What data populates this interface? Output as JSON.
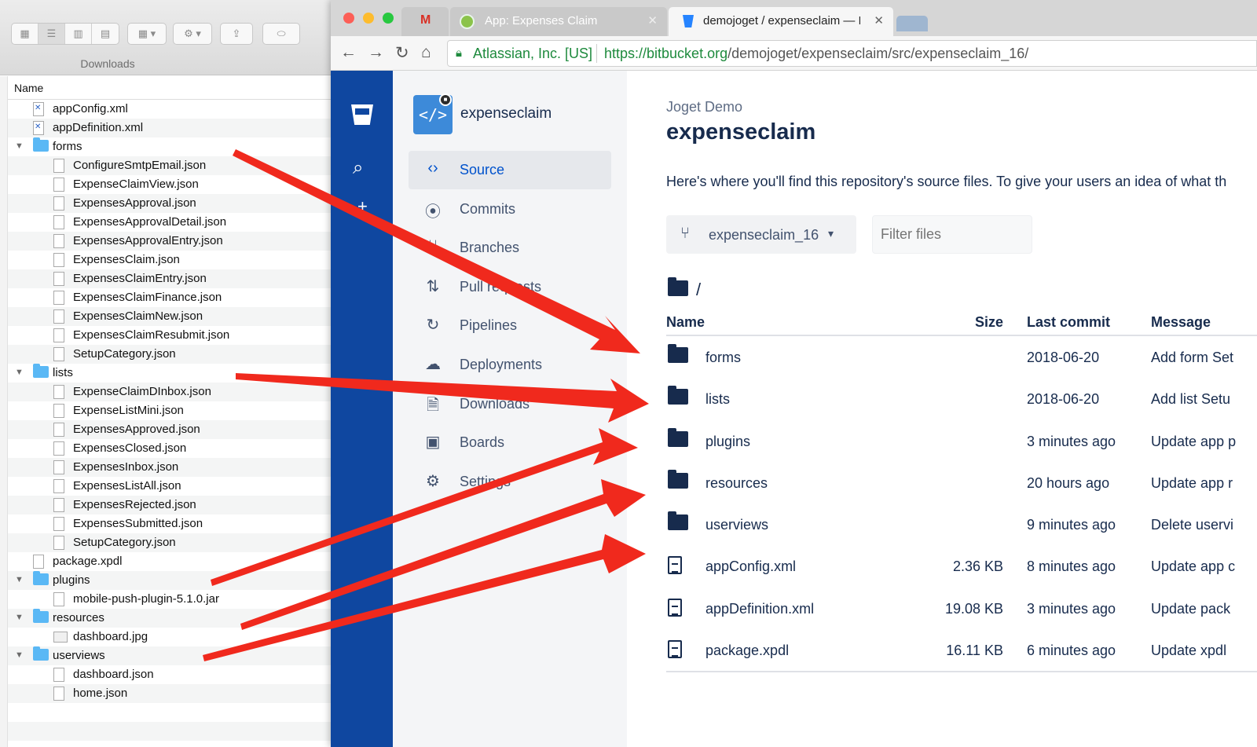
{
  "finder": {
    "title": "Downloads",
    "column_header": "Name",
    "rows": [
      {
        "name": "appConfig.xml",
        "indent": 1,
        "kind": "xml",
        "expanded": false
      },
      {
        "name": "appDefinition.xml",
        "indent": 1,
        "kind": "xml",
        "expanded": false
      },
      {
        "name": "forms",
        "indent": 1,
        "kind": "folder",
        "expanded": true
      },
      {
        "name": "ConfigureSmtpEmail.json",
        "indent": 2,
        "kind": "doc",
        "expanded": false
      },
      {
        "name": "ExpenseClaimView.json",
        "indent": 2,
        "kind": "doc",
        "expanded": false
      },
      {
        "name": "ExpensesApproval.json",
        "indent": 2,
        "kind": "doc",
        "expanded": false
      },
      {
        "name": "ExpensesApprovalDetail.json",
        "indent": 2,
        "kind": "doc",
        "expanded": false
      },
      {
        "name": "ExpensesApprovalEntry.json",
        "indent": 2,
        "kind": "doc",
        "expanded": false
      },
      {
        "name": "ExpensesClaim.json",
        "indent": 2,
        "kind": "doc",
        "expanded": false
      },
      {
        "name": "ExpensesClaimEntry.json",
        "indent": 2,
        "kind": "doc",
        "expanded": false
      },
      {
        "name": "ExpensesClaimFinance.json",
        "indent": 2,
        "kind": "doc",
        "expanded": false
      },
      {
        "name": "ExpensesClaimNew.json",
        "indent": 2,
        "kind": "doc",
        "expanded": false
      },
      {
        "name": "ExpensesClaimResubmit.json",
        "indent": 2,
        "kind": "doc",
        "expanded": false
      },
      {
        "name": "SetupCategory.json",
        "indent": 2,
        "kind": "doc",
        "expanded": false
      },
      {
        "name": "lists",
        "indent": 1,
        "kind": "folder",
        "expanded": true
      },
      {
        "name": "ExpenseClaimDInbox.json",
        "indent": 2,
        "kind": "doc",
        "expanded": false
      },
      {
        "name": "ExpenseListMini.json",
        "indent": 2,
        "kind": "doc",
        "expanded": false
      },
      {
        "name": "ExpensesApproved.json",
        "indent": 2,
        "kind": "doc",
        "expanded": false
      },
      {
        "name": "ExpensesClosed.json",
        "indent": 2,
        "kind": "doc",
        "expanded": false
      },
      {
        "name": "ExpensesInbox.json",
        "indent": 2,
        "kind": "doc",
        "expanded": false
      },
      {
        "name": "ExpensesListAll.json",
        "indent": 2,
        "kind": "doc",
        "expanded": false
      },
      {
        "name": "ExpensesRejected.json",
        "indent": 2,
        "kind": "doc",
        "expanded": false
      },
      {
        "name": "ExpensesSubmitted.json",
        "indent": 2,
        "kind": "doc",
        "expanded": false
      },
      {
        "name": "SetupCategory.json",
        "indent": 2,
        "kind": "doc",
        "expanded": false
      },
      {
        "name": "package.xpdl",
        "indent": 1,
        "kind": "doc",
        "expanded": false
      },
      {
        "name": "plugins",
        "indent": 1,
        "kind": "folder",
        "expanded": true
      },
      {
        "name": "mobile-push-plugin-5.1.0.jar",
        "indent": 2,
        "kind": "doc",
        "expanded": false
      },
      {
        "name": "resources",
        "indent": 1,
        "kind": "folder",
        "expanded": true
      },
      {
        "name": "dashboard.jpg",
        "indent": 2,
        "kind": "image",
        "expanded": false
      },
      {
        "name": "userviews",
        "indent": 1,
        "kind": "folder",
        "expanded": true
      },
      {
        "name": "dashboard.json",
        "indent": 2,
        "kind": "doc",
        "expanded": false
      },
      {
        "name": "home.json",
        "indent": 2,
        "kind": "doc",
        "expanded": false
      }
    ]
  },
  "browser": {
    "tabs": [
      {
        "label": "",
        "icon": "gmail-icon"
      },
      {
        "label": "App: Expenses Claim",
        "icon": "joget-icon"
      },
      {
        "label": "demojoget / expenseclaim — B",
        "icon": "bitbucket-icon"
      }
    ],
    "site_org": "Atlassian, Inc. [US]",
    "url_scheme_host": "https://bitbucket.org",
    "url_path": "/demojoget/expenseclaim/src/expenseclaim_16/"
  },
  "bitbucket": {
    "repo_name": "expenseclaim",
    "nav": [
      {
        "label": "Source",
        "icon": "code-icon",
        "active": true
      },
      {
        "label": "Commits",
        "icon": "commit-icon",
        "active": false
      },
      {
        "label": "Branches",
        "icon": "branch-icon",
        "active": false
      },
      {
        "label": "Pull requests",
        "icon": "pull-request-icon",
        "active": false
      },
      {
        "label": "Pipelines",
        "icon": "pipelines-icon",
        "active": false
      },
      {
        "label": "Deployments",
        "icon": "cloud-upload-icon",
        "active": false
      },
      {
        "label": "Downloads",
        "icon": "download-file-icon",
        "active": false
      },
      {
        "label": "Boards",
        "icon": "boards-icon",
        "active": false
      },
      {
        "label": "Settings",
        "icon": "gear-icon",
        "active": false
      }
    ],
    "owner": "Joget Demo",
    "title": "expenseclaim",
    "intro": "Here's where you'll find this repository's source files. To give your users an idea of what th",
    "branch": "expenseclaim_16",
    "filter_placeholder": "Filter files",
    "breadcrumb": "/",
    "columns": {
      "name": "Name",
      "size": "Size",
      "last_commit": "Last commit",
      "message": "Message"
    },
    "files": [
      {
        "name": "forms",
        "type": "folder",
        "size": "",
        "last_commit": "2018-06-20",
        "message": "Add form Set"
      },
      {
        "name": "lists",
        "type": "folder",
        "size": "",
        "last_commit": "2018-06-20",
        "message": "Add list Setu"
      },
      {
        "name": "plugins",
        "type": "folder",
        "size": "",
        "last_commit": "3 minutes ago",
        "message": "Update app p"
      },
      {
        "name": "resources",
        "type": "folder",
        "size": "",
        "last_commit": "20 hours ago",
        "message": "Update app r"
      },
      {
        "name": "userviews",
        "type": "folder",
        "size": "",
        "last_commit": "9 minutes ago",
        "message": "Delete uservi"
      },
      {
        "name": "appConfig.xml",
        "type": "file",
        "size": "2.36 KB",
        "last_commit": "8 minutes ago",
        "message": "Update app c"
      },
      {
        "name": "appDefinition.xml",
        "type": "file",
        "size": "19.08 KB",
        "last_commit": "3 minutes ago",
        "message": "Update pack"
      },
      {
        "name": "package.xpdl",
        "type": "file",
        "size": "16.11 KB",
        "last_commit": "6 minutes ago",
        "message": "Update xpdl"
      }
    ]
  },
  "colors": {
    "bitbucket_blue": "#0f47a0",
    "annotation_red": "#f0291d",
    "secure_green": "#1e8a3d"
  }
}
